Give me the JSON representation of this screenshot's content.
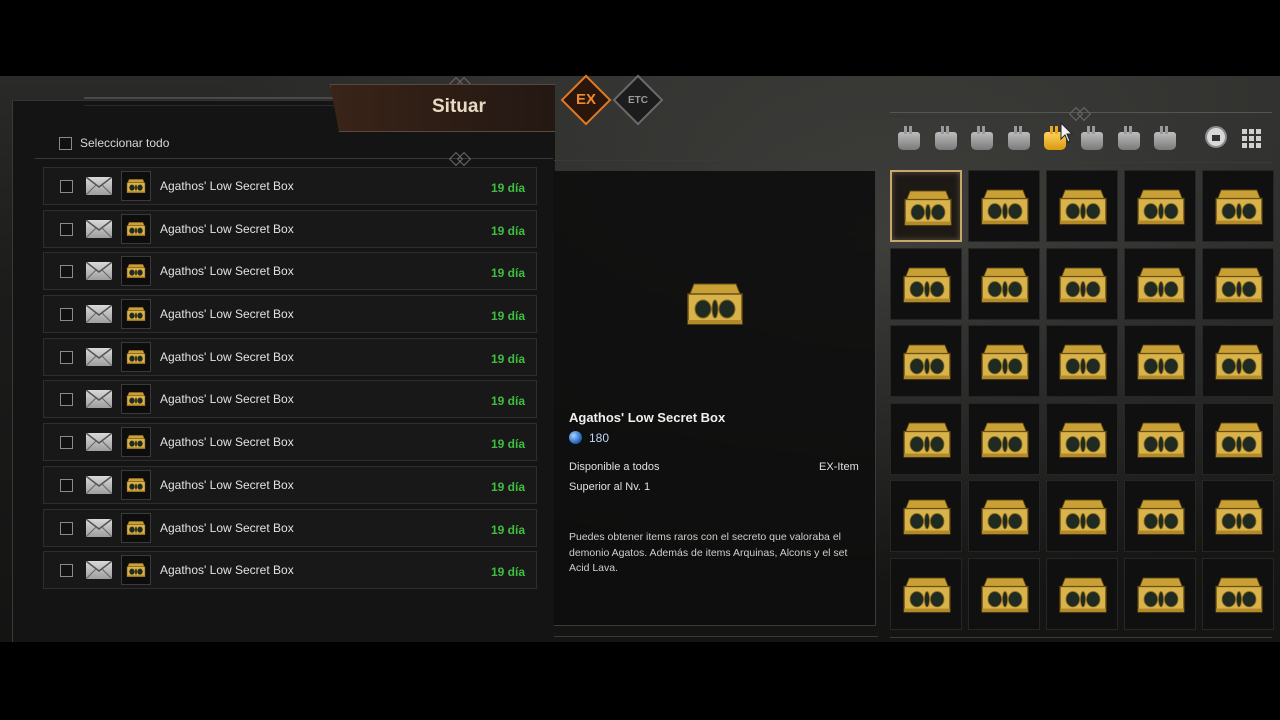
{
  "mail_panel": {
    "tab_label": "Situar",
    "select_all_label": "Seleccionar todo",
    "items": [
      {
        "title": "Agathos' Low Secret Box",
        "days": "19 día"
      },
      {
        "title": "Agathos' Low Secret Box",
        "days": "19 día"
      },
      {
        "title": "Agathos' Low Secret Box",
        "days": "19 día"
      },
      {
        "title": "Agathos' Low Secret Box",
        "days": "19 día"
      },
      {
        "title": "Agathos' Low Secret Box",
        "days": "19 día"
      },
      {
        "title": "Agathos' Low Secret Box",
        "days": "19 día"
      },
      {
        "title": "Agathos' Low Secret Box",
        "days": "19 día"
      },
      {
        "title": "Agathos' Low Secret Box",
        "days": "19 día"
      },
      {
        "title": "Agathos' Low Secret Box",
        "days": "19 día"
      },
      {
        "title": "Agathos' Low Secret Box",
        "days": "19 día"
      }
    ]
  },
  "filter_tabs": [
    {
      "label": "EX",
      "active": true
    },
    {
      "label": "ETC",
      "active": false
    }
  ],
  "item_detail": {
    "name": "Agathos' Low Secret Box",
    "price": "180",
    "availability": "Disponible a todos",
    "type": "EX-Item",
    "level_req": "Superior al Nv. 1",
    "description": "Puedes obtener items raros con el secreto que valoraba el demonio Agatos. Además de items Arquinas, Alcons y el set Acid Lava."
  },
  "inventory": {
    "bag_tabs_count": 8,
    "active_bag_tab": 4,
    "cell_count": 30,
    "selected_cell": 0,
    "cell_item_icon": "gold-chest-icon"
  },
  "colors": {
    "accent_orange": "#e07a25",
    "days_green": "#3fbf3f",
    "gold": "#d89a12",
    "selection_border": "#c9a66b"
  }
}
